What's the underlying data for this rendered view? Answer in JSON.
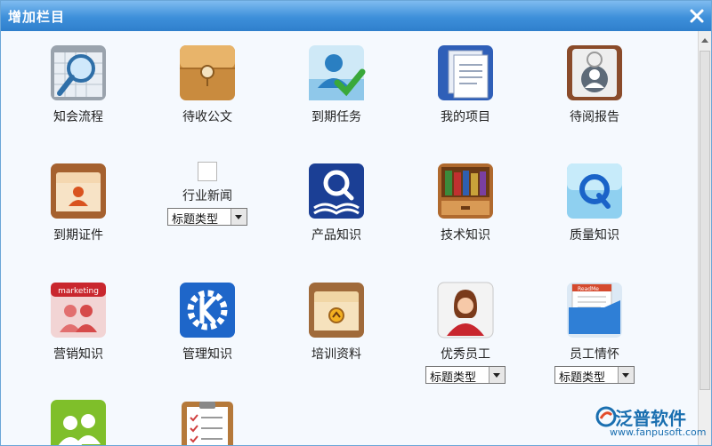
{
  "window": {
    "title": "增加栏目"
  },
  "items": [
    {
      "label": "知会流程",
      "icon": "search-calendar-icon"
    },
    {
      "label": "待收公文",
      "icon": "envelope-icon"
    },
    {
      "label": "到期任务",
      "icon": "user-check-icon"
    },
    {
      "label": "我的项目",
      "icon": "documents-icon"
    },
    {
      "label": "待阅报告",
      "icon": "report-user-icon"
    },
    {
      "label": "到期证件",
      "icon": "folder-user-icon"
    },
    {
      "label": "行业新闻",
      "icon": "broken-image-icon",
      "select": "标题类型"
    },
    {
      "label": "产品知识",
      "icon": "book-search-icon"
    },
    {
      "label": "技术知识",
      "icon": "bookshelf-icon"
    },
    {
      "label": "质量知识",
      "icon": "q-logo-icon"
    },
    {
      "label": "营销知识",
      "icon": "marketing-users-icon",
      "badge": "marketing"
    },
    {
      "label": "管理知识",
      "icon": "kde-gear-icon"
    },
    {
      "label": "培训资料",
      "icon": "folder-emblem-icon"
    },
    {
      "label": "优秀员工",
      "icon": "female-user-icon",
      "select": "标题类型"
    },
    {
      "label": "员工情怀",
      "icon": "folder-readme-icon",
      "select": "标题类型",
      "note": "ReadMe"
    },
    {
      "label": "",
      "icon": "group-users-icon"
    },
    {
      "label": "",
      "icon": "clipboard-checklist-icon"
    }
  ],
  "watermark": {
    "brand": "泛普软件",
    "url": "www.fanpusoft.com"
  }
}
